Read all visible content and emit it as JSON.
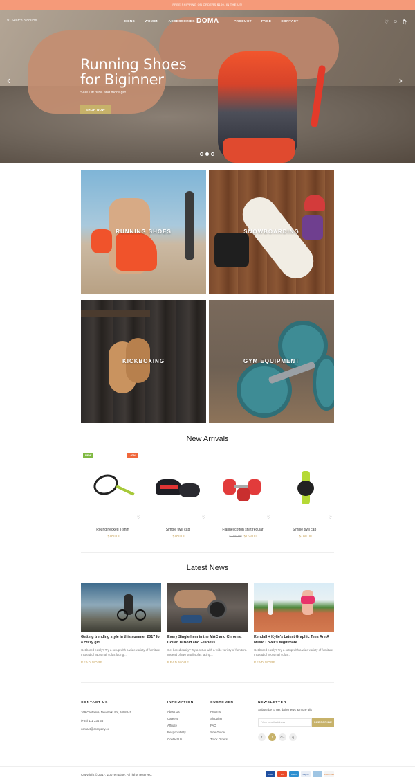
{
  "topbar": {
    "text": "FREE SHIPPING ON ORDERS $100. IN THE US!"
  },
  "nav": {
    "search_placeholder": "Search products",
    "left_items": [
      "MENS",
      "WOMEN",
      "ACCESSORIES"
    ],
    "logo": "DOMA",
    "right_items": [
      "PRODUCT",
      "PAGE",
      "CONTACT"
    ],
    "icons": [
      "heart-icon",
      "user-icon",
      "cart-icon"
    ]
  },
  "hero": {
    "title_line1": "Running Shoes",
    "title_line2": "for Biginner",
    "subtitle": "Sale Off 30% and more gift",
    "button": "SHOP NOW"
  },
  "categories": [
    {
      "label": "RUNNING SHOES"
    },
    {
      "label": "SNOWBOARDING"
    },
    {
      "label": "KICKBOXING"
    },
    {
      "label": "GYM EQUIPMENT"
    }
  ],
  "new_arrivals": {
    "title": "New Arrivals",
    "badges": {
      "new": "NEW",
      "sale": "-40%"
    },
    "products": [
      {
        "name": "Round necked T-shirt",
        "price": "$180.00",
        "old_price": ""
      },
      {
        "name": "Simple twill cap",
        "price": "$180.00",
        "old_price": ""
      },
      {
        "name": "Flannel cotton shirt regular",
        "price": "$169.00",
        "old_price": "$180.00"
      },
      {
        "name": "Simple twill cap",
        "price": "$180.00",
        "old_price": ""
      }
    ]
  },
  "news": {
    "title": "Latest News",
    "items": [
      {
        "title": "Getting trending style in this summer 2017 for a crazy girl",
        "excerpt": "Get bored easily? Try a setup with a wide variety of furniture. Instead of two small sofas facing...",
        "more": "READ MORE"
      },
      {
        "title": "Every Single Item in the MAC and Chromat Collab Is Bold and Fearless",
        "excerpt": "Get bored easily? Try a setup with a wide variety of furniture. Instead of two small sofas facing...",
        "more": "READ MORE"
      },
      {
        "title": "Kendall + Kylie's Latest Graphic Tees Are A Music Lover's Nightmare",
        "excerpt": "Get bored easily? Try a setup with a wide variety of furniture. Instead of two small sofas...",
        "more": "READ MORE"
      }
    ]
  },
  "footer": {
    "contact": {
      "heading": "CONTACT US",
      "lines": [
        "169 California, NewYork, NY, 1008345",
        "(+84) 111 234 567",
        "contact@company.co"
      ]
    },
    "information": {
      "heading": "INFOMATION",
      "links": [
        "About Us",
        "Careers",
        "Affiliate",
        "Responsibility",
        "Contact Us"
      ]
    },
    "customer": {
      "heading": "CUSTOMER",
      "links": [
        "Returns",
        "Shipping",
        "FAQ",
        "Size Guide",
        "Track Orders"
      ]
    },
    "newsletter": {
      "heading": "NEWSLETTER",
      "text": "Subscribe to get daily news & more gift",
      "placeholder": "Your email address",
      "button": "SUBSCRIBE"
    },
    "social": [
      "f",
      "t",
      "G+",
      "ig"
    ],
    "copyright": "Copyright © 2017. ZooTemplate. All rights reserved.",
    "payments": [
      "VISA",
      "MC",
      "AMEX",
      "PayPal",
      "",
      "DISCOVER"
    ]
  },
  "colors": {
    "accent": "#c7b26a",
    "topbar": "#f59a79",
    "price": "#c7a35a",
    "new_badge": "#80b942",
    "sale_badge": "#f0673b"
  }
}
